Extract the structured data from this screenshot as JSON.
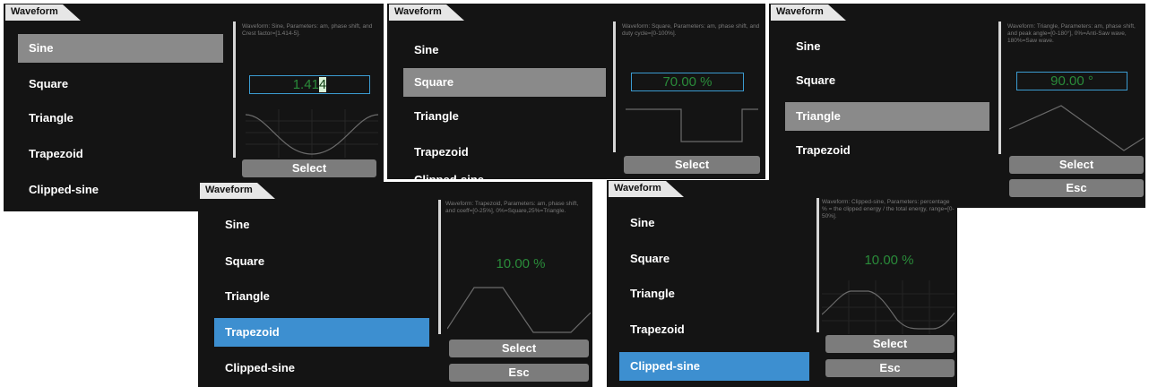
{
  "tab_title": "Waveform",
  "items": [
    "Sine",
    "Square",
    "Triangle",
    "Trapezoid",
    "Clipped-sine"
  ],
  "buttons": {
    "select": "Select",
    "esc": "Esc"
  },
  "screens": {
    "sine": {
      "selected": "Sine",
      "description": "Waveform: Sine, Parameters: am, phase shift, and Crest factor=[1.414-5].",
      "value_main": "1.41",
      "value_cursor": "4"
    },
    "square": {
      "selected": "Square",
      "description": "Waveform: Square, Parameters: am, phase shift, and duty cycle=[0-100%].",
      "value": "70.00 %"
    },
    "triangle": {
      "selected": "Triangle",
      "description": "Waveform: Triangle, Parameters: am, phase shift, and peak angle=[0-180°], 0%=Anti-Saw wave, 180%=Saw wave.",
      "value": "90.00 °"
    },
    "trapezoid": {
      "selected": "Trapezoid",
      "description": "Waveform: Trapezoid, Parameters: am, phase shift, and coeff=[0-25%], 0%=Square,25%=Triangle.",
      "value": "10.00 %"
    },
    "clipped": {
      "selected": "Clipped-sine",
      "description": "Waveform: Clipped-sine, Parameters: percentage % = the clipped energy / the total energy, range=[0-50%].",
      "value": "10.00 %"
    }
  },
  "colors": {
    "background": "#141414",
    "selection_gray": "#8a8a8a",
    "selection_blue": "#3d8fd0",
    "value_green": "#2a8b3a",
    "box_border": "#3b9bd1",
    "button": "#7c7c7c"
  }
}
